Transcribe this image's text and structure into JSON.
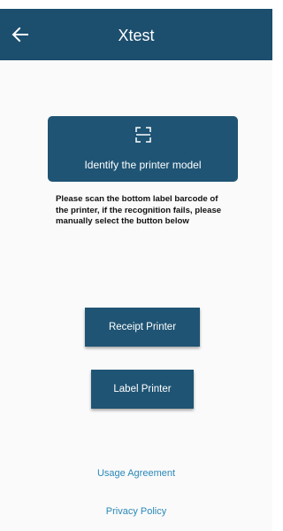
{
  "header": {
    "title": "Xtest",
    "back_icon": "arrow-left-icon"
  },
  "scan": {
    "icon": "scan-frame-icon",
    "label": "Identify the printer model"
  },
  "hint": "Please scan the bottom label barcode of the printer, if the recognition fails, please manually select the button below",
  "buttons": {
    "receipt": "Receipt Printer",
    "label": "Label Printer"
  },
  "links": {
    "usage": "Usage Agreement",
    "privacy": "Privacy Policy"
  },
  "colors": {
    "appbar": "#1c4e6e",
    "primary": "#1f5474",
    "link": "#2a88b8",
    "background": "#fafafa"
  }
}
